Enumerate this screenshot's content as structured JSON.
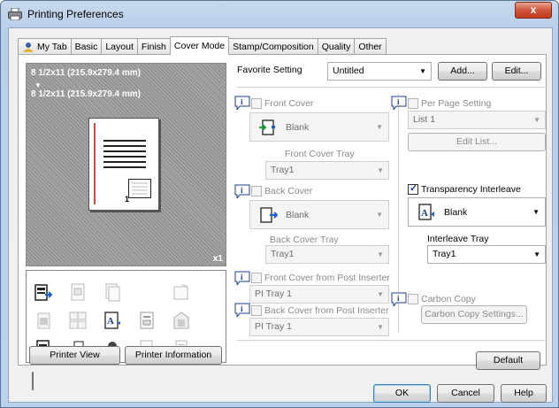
{
  "window": {
    "title": "Printing Preferences",
    "close_label": "x"
  },
  "tabs": [
    {
      "label": "My Tab",
      "active": false
    },
    {
      "label": "Basic",
      "active": false
    },
    {
      "label": "Layout",
      "active": false
    },
    {
      "label": "Finish",
      "active": false
    },
    {
      "label": "Cover Mode",
      "active": true
    },
    {
      "label": "Stamp/Composition",
      "active": false
    },
    {
      "label": "Quality",
      "active": false
    },
    {
      "label": "Other",
      "active": false
    }
  ],
  "preview": {
    "line1": "8 1/2x11 (215.9x279.4 mm)",
    "line2": "8 1/2x11 (215.9x279.4 mm)",
    "copies": "x1",
    "paper_mark": "1"
  },
  "buttons": {
    "printer_view": "Printer View",
    "printer_information": "Printer Information",
    "add": "Add...",
    "edit": "Edit...",
    "edit_list": "Edit List...",
    "carbon_copy_settings": "Carbon Copy Settings...",
    "default": "Default",
    "ok": "OK",
    "cancel": "Cancel",
    "help": "Help"
  },
  "favorite": {
    "label": "Favorite Setting",
    "value": "Untitled"
  },
  "front_cover": {
    "label": "Front Cover",
    "checked": false,
    "type": "Blank",
    "tray_label": "Front Cover Tray",
    "tray": "Tray1"
  },
  "back_cover": {
    "label": "Back Cover",
    "checked": false,
    "type": "Blank",
    "tray_label": "Back Cover Tray",
    "tray": "Tray1"
  },
  "front_cover_post": {
    "label": "Front Cover from Post Inserter",
    "checked": false,
    "tray": "PI Tray 1"
  },
  "back_cover_post": {
    "label": "Back Cover from Post Inserter",
    "checked": false,
    "tray": "PI Tray 1"
  },
  "per_page": {
    "label": "Per Page Setting",
    "checked": false,
    "list": "List 1"
  },
  "transparency": {
    "label": "Transparency Interleave",
    "checked": true,
    "type": "Blank",
    "tray_label": "Interleave Tray",
    "tray": "Tray1"
  },
  "carbon_copy": {
    "label": "Carbon Copy",
    "checked": false
  },
  "colors": {
    "accent": "#1a3d8f",
    "title_bar": "#bcd2ec",
    "close": "#c03a20"
  }
}
